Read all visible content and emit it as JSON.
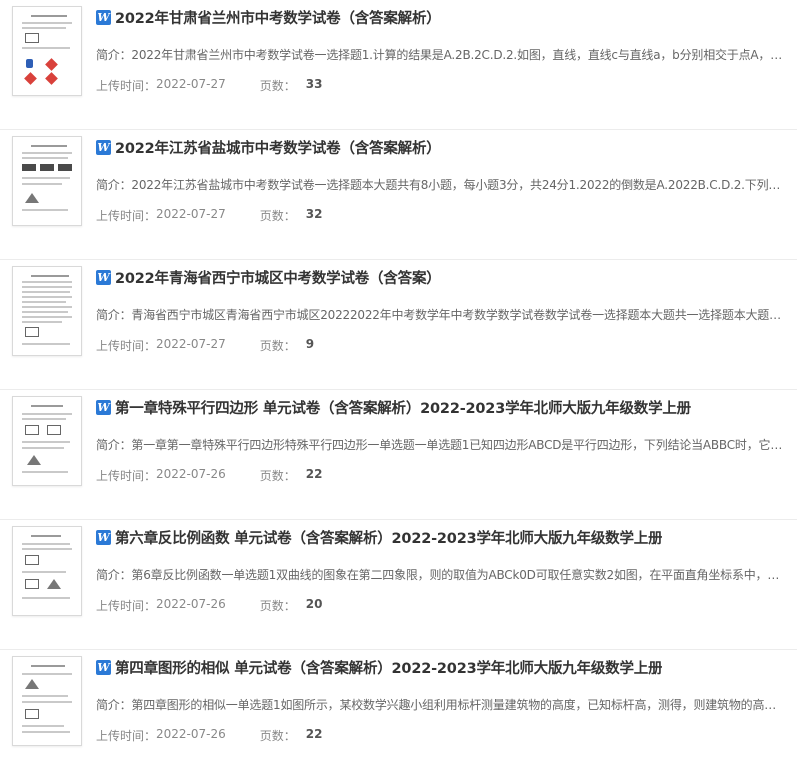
{
  "labels": {
    "summary_prefix": "简介：",
    "upload_time_prefix": "上传时间：",
    "pages_prefix": "页数："
  },
  "items": [
    {
      "title": "2022年甘肃省兰州市中考数学试卷（含答案解析）",
      "summary": "2022年甘肃省兰州市中考数学试卷一选择题1.计算的结果是A.2B.2C.D.2.如图，直线，直线c与直线a，b分别相交于点A，B…",
      "date": "2022-07-27",
      "pages": "33",
      "file_icon": "word-icon"
    },
    {
      "title": "2022年江苏省盐城市中考数学试卷（含答案解析）",
      "summary": "2022年江苏省盐城市中考数学试卷一选择题本大题共有8小题，每小题3分，共24分1.2022的倒数是A.2022B.C.D.2.下列计…",
      "date": "2022-07-27",
      "pages": "32",
      "file_icon": "word-icon"
    },
    {
      "title": "2022年青海省西宁市城区中考数学试卷（含答案）",
      "summary": "青海省西宁市城区青海省西宁市城区20222022年中考数学年中考数学数学试卷数学试卷一选择题本大题共一选择题本大题…",
      "date": "2022-07-27",
      "pages": "9",
      "file_icon": "word-icon"
    },
    {
      "title": "第一章特殊平行四边形 单元试卷（含答案解析）2022-2023学年北师大版九年级数学上册",
      "summary": "第一章第一章特殊平行四边形特殊平行四边形一单选题一单选题1已知四边形ABCD是平行四边形，下列结论当ABBC时，它…",
      "date": "2022-07-26",
      "pages": "22",
      "file_icon": "word-icon"
    },
    {
      "title": "第六章反比例函数 单元试卷（含答案解析）2022-2023学年北师大版九年级数学上册",
      "summary": "第6章反比例函数一单选题1双曲线的图象在第二四象限，则的取值为ABCk0D可取任意实数2如图，在平面直角坐标系中，…",
      "date": "2022-07-26",
      "pages": "20",
      "file_icon": "word-icon"
    },
    {
      "title": "第四章图形的相似 单元试卷（含答案解析）2022-2023学年北师大版九年级数学上册",
      "summary": "第四章图形的相似一单选题1如图所示，某校数学兴趣小组利用标杆测量建筑物的高度，已知标杆高，测得，则建筑物的高…",
      "date": "2022-07-26",
      "pages": "22",
      "file_icon": "word-icon"
    }
  ],
  "colors": {
    "word_icon_bg": "#2b79d6",
    "title_text": "#333333",
    "meta_text": "#888888"
  }
}
